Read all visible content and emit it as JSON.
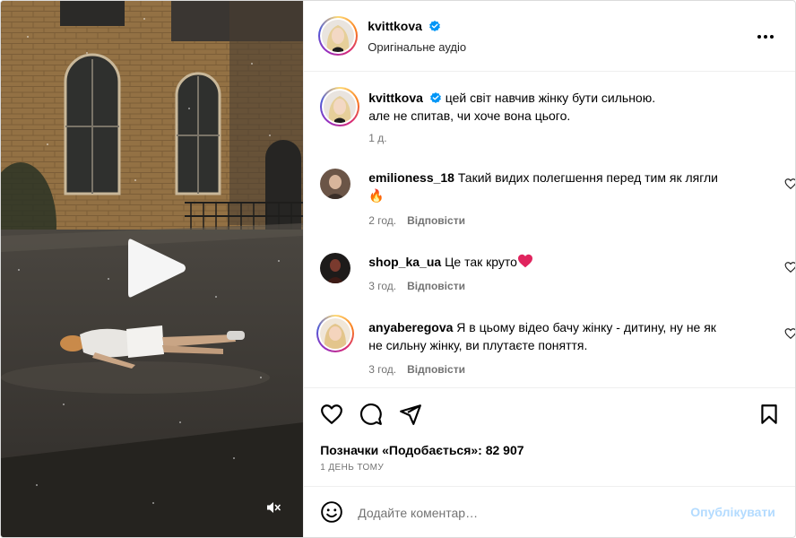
{
  "video": {
    "play_icon": "play-icon",
    "mute_icon": "speaker-muted-icon"
  },
  "header": {
    "username": "kvittkova",
    "audio": "Оригінальне аудіо",
    "more_icon": "more-horizontal-icon"
  },
  "caption": {
    "username": "kvittkova",
    "text_line1": "цей світ навчив жінку бути сильною.",
    "text_line2": "але не спитав, чи хоче вона цього.",
    "time": "1 д."
  },
  "comments": [
    {
      "username": "emilioness_18",
      "text_line1": "Такий видих полегшення перед тим як лягли",
      "text_line2": "🔥",
      "time": "2 год.",
      "reply": "Відповісти"
    },
    {
      "username": "shop_ka_ua",
      "text_line1": "Це так круто",
      "text_line2": "",
      "time": "3 год.",
      "reply": "Відповісти"
    },
    {
      "username": "anyaberegova",
      "text_line1": "Я в цьому відео бачу жінку - дитину, ну не як",
      "text_line2": "не сильну жінку, ви плутаєте поняття.",
      "time": "3 год.",
      "reply": "Відповісти"
    }
  ],
  "actions": {
    "like_icon": "heart-icon",
    "comment_icon": "comment-icon",
    "share_icon": "send-icon",
    "save_icon": "bookmark-icon",
    "likes_text": "Позначки «Подобається»: 82 907",
    "date": "1 ДЕНЬ ТОМУ"
  },
  "add_comment": {
    "placeholder": "Додайте коментар…",
    "post_label": "Опублікувати",
    "emoji_icon": "emoji-icon"
  },
  "colors": {
    "verified": "#0095f6",
    "post_button_disabled": "#b3dbff",
    "muted_text": "#737373"
  }
}
